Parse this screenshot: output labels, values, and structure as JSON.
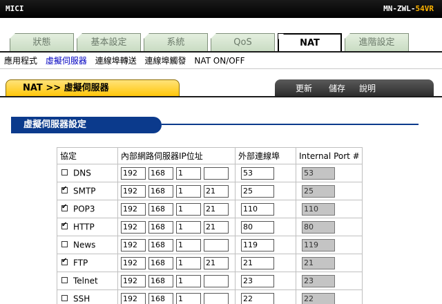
{
  "header": {
    "brand": "MICI",
    "model_prefix": "MN-ZWL-",
    "model_suffix": "54VR"
  },
  "tabs": [
    "狀態",
    "基本設定",
    "系統",
    "QoS",
    "NAT",
    "進階設定"
  ],
  "subnav": [
    "應用程式",
    "虛擬伺服器",
    "連線埠轉送",
    "連線埠觸發",
    "NAT ON/OFF"
  ],
  "breadcrumb": {
    "root": "NAT",
    "arrow": ">>",
    "page": "虛擬伺服器"
  },
  "actions": {
    "refresh": "更新",
    "save": "儲存",
    "help": "說明"
  },
  "section_title": "虛擬伺服器設定",
  "table": {
    "headers": [
      "協定",
      "內部網路伺服器IP位址",
      "外部連線埠",
      "Internal Port #"
    ],
    "rows": [
      {
        "checked": false,
        "name": "DNS",
        "ip": [
          "192",
          "168",
          "1",
          ""
        ],
        "ext": "53",
        "int": "53"
      },
      {
        "checked": true,
        "name": "SMTP",
        "ip": [
          "192",
          "168",
          "1",
          "21"
        ],
        "ext": "25",
        "int": "25"
      },
      {
        "checked": true,
        "name": "POP3",
        "ip": [
          "192",
          "168",
          "1",
          "21"
        ],
        "ext": "110",
        "int": "110"
      },
      {
        "checked": true,
        "name": "HTTP",
        "ip": [
          "192",
          "168",
          "1",
          "21"
        ],
        "ext": "80",
        "int": "80"
      },
      {
        "checked": false,
        "name": "News",
        "ip": [
          "192",
          "168",
          "1",
          ""
        ],
        "ext": "119",
        "int": "119"
      },
      {
        "checked": true,
        "name": "FTP",
        "ip": [
          "192",
          "168",
          "1",
          "21"
        ],
        "ext": "21",
        "int": "21"
      },
      {
        "checked": false,
        "name": "Telnet",
        "ip": [
          "192",
          "168",
          "1",
          ""
        ],
        "ext": "23",
        "int": "23"
      },
      {
        "checked": false,
        "name": "SSH",
        "ip": [
          "192",
          "168",
          "1",
          ""
        ],
        "ext": "22",
        "int": "22"
      }
    ]
  }
}
